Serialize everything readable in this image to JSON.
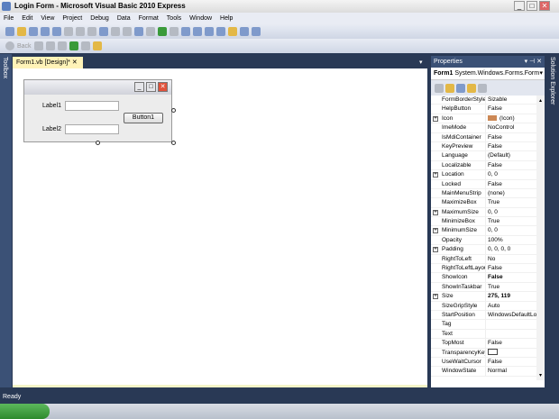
{
  "window": {
    "title": "Login Form - Microsoft Visual Basic 2010 Express"
  },
  "menu": [
    "File",
    "Edit",
    "View",
    "Project",
    "Debug",
    "Data",
    "Format",
    "Tools",
    "Window",
    "Help"
  ],
  "toolbar2": {
    "back_label": "Back"
  },
  "toolbox_label": "Toolbox",
  "solution_explorer_label": "Solution Explorer",
  "doc_tab": {
    "label": "Form1.vb [Design]*",
    "close": "✕"
  },
  "form": {
    "label1": "Label1",
    "label2": "Label2",
    "button1": "Button1"
  },
  "properties": {
    "title": "Properties",
    "pin": "▾ ⊣ ✕",
    "object_name": "Form1",
    "object_type": "System.Windows.Forms.Form",
    "rows": [
      {
        "name": "FormBorderStyle",
        "value": "Sizable"
      },
      {
        "name": "HelpButton",
        "value": "False"
      },
      {
        "name": "Icon",
        "value": "(Icon)",
        "expand": true
      },
      {
        "name": "ImeMode",
        "value": "NoControl"
      },
      {
        "name": "IsMdiContainer",
        "value": "False"
      },
      {
        "name": "KeyPreview",
        "value": "False"
      },
      {
        "name": "Language",
        "value": "(Default)"
      },
      {
        "name": "Localizable",
        "value": "False"
      },
      {
        "name": "Location",
        "value": "0, 0",
        "expand": true
      },
      {
        "name": "Locked",
        "value": "False"
      },
      {
        "name": "MainMenuStrip",
        "value": "(none)"
      },
      {
        "name": "MaximizeBox",
        "value": "True"
      },
      {
        "name": "MaximumSize",
        "value": "0, 0",
        "expand": true
      },
      {
        "name": "MinimizeBox",
        "value": "True"
      },
      {
        "name": "MinimumSize",
        "value": "0, 0",
        "expand": true
      },
      {
        "name": "Opacity",
        "value": "100%"
      },
      {
        "name": "Padding",
        "value": "0, 0, 0, 0",
        "expand": true
      },
      {
        "name": "RightToLeft",
        "value": "No"
      },
      {
        "name": "RightToLeftLayout",
        "value": "False"
      },
      {
        "name": "ShowIcon",
        "value": "False",
        "bold": true
      },
      {
        "name": "ShowInTaskbar",
        "value": "True"
      },
      {
        "name": "Size",
        "value": "275, 119",
        "expand": true,
        "bold": true
      },
      {
        "name": "SizeGripStyle",
        "value": "Auto"
      },
      {
        "name": "StartPosition",
        "value": "WindowsDefaultLocation"
      },
      {
        "name": "Tag",
        "value": ""
      },
      {
        "name": "Text",
        "value": ""
      },
      {
        "name": "TopMost",
        "value": "False"
      },
      {
        "name": "TransparencyKey",
        "value": ""
      },
      {
        "name": "UseWaitCursor",
        "value": "False"
      },
      {
        "name": "WindowState",
        "value": "Normal"
      }
    ]
  },
  "status": "Ready"
}
